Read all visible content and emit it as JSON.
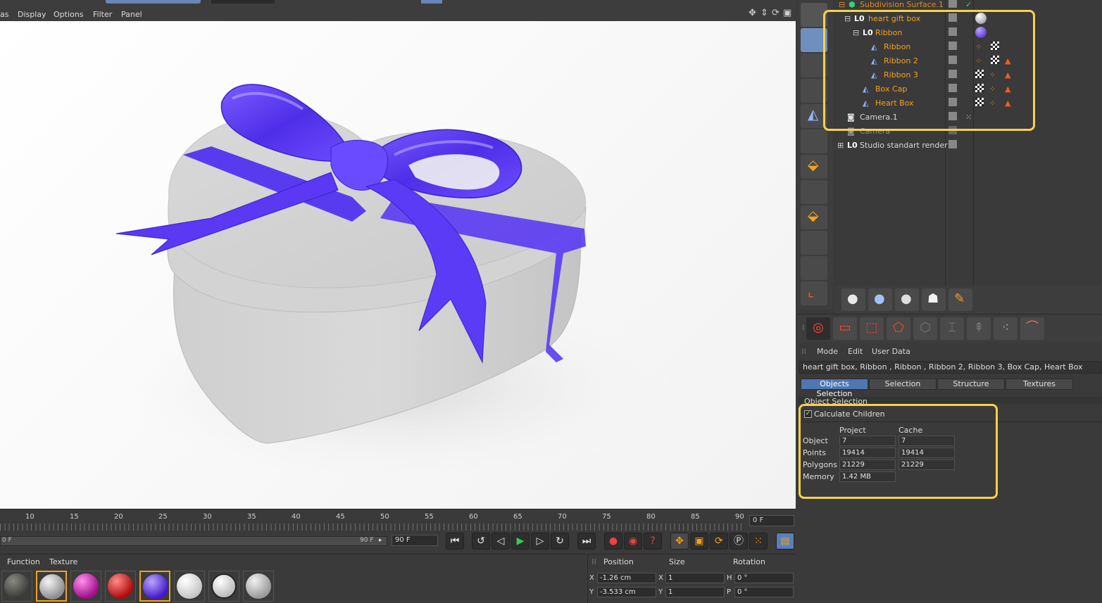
{
  "viewport": {
    "menu": [
      "as",
      "Display",
      "Options",
      "Filter",
      "Panel"
    ]
  },
  "timeline": {
    "ticks": [
      "10",
      "15",
      "20",
      "25",
      "30",
      "35",
      "40",
      "45",
      "50",
      "55",
      "60",
      "65",
      "70",
      "75",
      "80",
      "85",
      "90"
    ],
    "current_frame": "0 F",
    "range_start": "0 F",
    "range_end": "90 F",
    "end_frame": "90 F"
  },
  "materials": {
    "menu": [
      "Function",
      "Texture"
    ],
    "swatches": [
      {
        "name": "dark-grey-material",
        "color": "#5a5a56"
      },
      {
        "name": "grey-material",
        "color": "#a8a8a8"
      },
      {
        "name": "magenta-material",
        "color": "#c41ea6"
      },
      {
        "name": "red-material",
        "color": "#d41818"
      },
      {
        "name": "purple-material",
        "color": "#5a2bd6"
      },
      {
        "name": "white-material",
        "color": "#e9e9e9"
      },
      {
        "name": "studio-material",
        "color": "#dcdcdc"
      },
      {
        "name": "light-grey-material",
        "color": "#bdbdbd"
      }
    ]
  },
  "coords": {
    "headers": [
      "Position",
      "Size",
      "Rotation"
    ],
    "rows": [
      {
        "axis": "X",
        "position": "-1.26 cm",
        "size_axis": "X",
        "size": "1",
        "rot_axis": "H",
        "rotation": "0 °"
      },
      {
        "axis": "Y",
        "position": "-3.533 cm",
        "size_axis": "Y",
        "size": "1",
        "rot_axis": "P",
        "rotation": "0 °"
      }
    ]
  },
  "objects": {
    "rows": [
      {
        "name": "Subdivision Surface.1",
        "color": "#e28a1c"
      },
      {
        "name": "heart gift box",
        "color": "#f4a11b"
      },
      {
        "name": "Ribbon",
        "color": "#f4a11b"
      },
      {
        "name": "Ribbon",
        "color": "#f4a11b"
      },
      {
        "name": "Ribbon 2",
        "color": "#f4a11b"
      },
      {
        "name": "Ribbon 3",
        "color": "#f4a11b"
      },
      {
        "name": "Box Cap",
        "color": "#f4a11b"
      },
      {
        "name": "Heart Box",
        "color": "#f4a11b"
      },
      {
        "name": "Camera.1",
        "color": "#d8d8d8"
      },
      {
        "name": "Camera",
        "color": "#d8d8d8"
      },
      {
        "name": "Studio standart render",
        "color": "#d8d8d8"
      }
    ]
  },
  "attributes": {
    "menu": [
      "Mode",
      "Edit",
      "User Data"
    ],
    "selection_names": "heart gift box, Ribbon , Ribbon , Ribbon 2, Ribbon 3, Box Cap, Heart Box",
    "tabs": [
      "Objects Selection",
      "Selection",
      "Structure",
      "Textures"
    ],
    "section_title": "Object Selection",
    "calculate_children": "Calculate Children",
    "col_project": "Project",
    "col_cache": "Cache",
    "stats": [
      {
        "label": "Object",
        "project": "7",
        "cache": "7"
      },
      {
        "label": "Points",
        "project": "19414",
        "cache": "19414"
      },
      {
        "label": "Polygons",
        "project": "21229",
        "cache": "21229"
      },
      {
        "label": "Memory",
        "project": "1.42 MB",
        "cache": ""
      }
    ]
  },
  "colors": {
    "accent": "#f4a11b",
    "highlight": "#f5d24b",
    "selection_blue": "#4e77b4",
    "ribbon": "#5a35f0"
  }
}
